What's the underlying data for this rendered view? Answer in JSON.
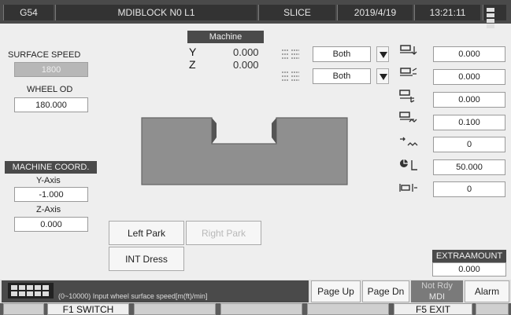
{
  "topbar": {
    "coord_system": "G54",
    "program": "MDIBLOCK N0 L1",
    "mode": "SLICE",
    "date": "2019/4/19",
    "time": "13:21:11"
  },
  "left_panel": {
    "surface_speed_label": "SURFACE SPEED",
    "surface_speed_value": "1800",
    "wheel_od_label": "WHEEL OD",
    "wheel_od_value": "180.000",
    "machine_coord_label": "MACHINE COORD.",
    "y_axis_label": "Y-Axis",
    "y_axis_value": "-1.000",
    "z_axis_label": "Z-Axis",
    "z_axis_value": "0.000"
  },
  "machine_position": {
    "title": "Machine",
    "y_letter": "Y",
    "y_value": "0.000",
    "z_letter": "Z",
    "z_value": "0.000"
  },
  "dropdowns": [
    {
      "selected": "Both"
    },
    {
      "selected": "Both"
    }
  ],
  "right_params": [
    {
      "icon": "dress-depth-icon",
      "value": "0.000"
    },
    {
      "icon": "dress-angle-icon",
      "value": "0.000"
    },
    {
      "icon": "dress-feed-icon",
      "value": "0.000"
    },
    {
      "icon": "dress-finish-icon",
      "value": "0.100"
    },
    {
      "icon": "passes-icon",
      "value": "0"
    },
    {
      "icon": "wheel-speed-icon",
      "value": "50.000"
    },
    {
      "icon": "count-icon",
      "value": "0"
    }
  ],
  "buttons": {
    "left_park": "Left Park",
    "right_park": "Right Park",
    "int_dress": "INT Dress"
  },
  "extra_amount": {
    "label": "EXTRAAMOUNT",
    "value": "0.000"
  },
  "status": {
    "message": "(0~10000) Input wheel surface speed[m(ft)/min]",
    "page_up": "Page Up",
    "page_dn": "Page Dn",
    "not_ready": "Not Rdy",
    "mode": "MDI",
    "alarm": "Alarm"
  },
  "function_keys": {
    "f1": "F1 SWITCH",
    "f5": "F5 EXIT"
  },
  "colors": {
    "bar": "#4a4a4a",
    "workpiece": "#8f8f8f",
    "background": "#eeeeee"
  }
}
